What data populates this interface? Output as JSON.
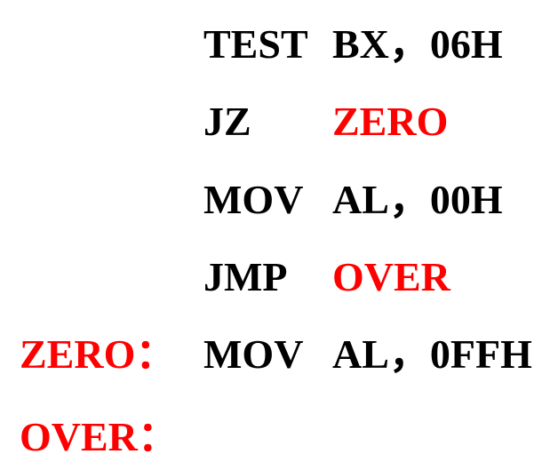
{
  "lines": [
    {
      "label": "",
      "mnemonic": "TEST",
      "operand": "BX，06H"
    },
    {
      "label": "",
      "mnemonic": "JZ",
      "operand": "ZERO"
    },
    {
      "label": "",
      "mnemonic": "MOV",
      "operand": "AL，00H"
    },
    {
      "label": "",
      "mnemonic": "JMP",
      "operand": "OVER"
    },
    {
      "label": "ZERO：",
      "mnemonic": "MOV",
      "operand": "AL，0FFH"
    },
    {
      "label": "OVER：",
      "mnemonic": "",
      "operand": ""
    }
  ],
  "colors": {
    "text": "#000000",
    "highlight": "#ff0000",
    "background": "#ffffff"
  }
}
